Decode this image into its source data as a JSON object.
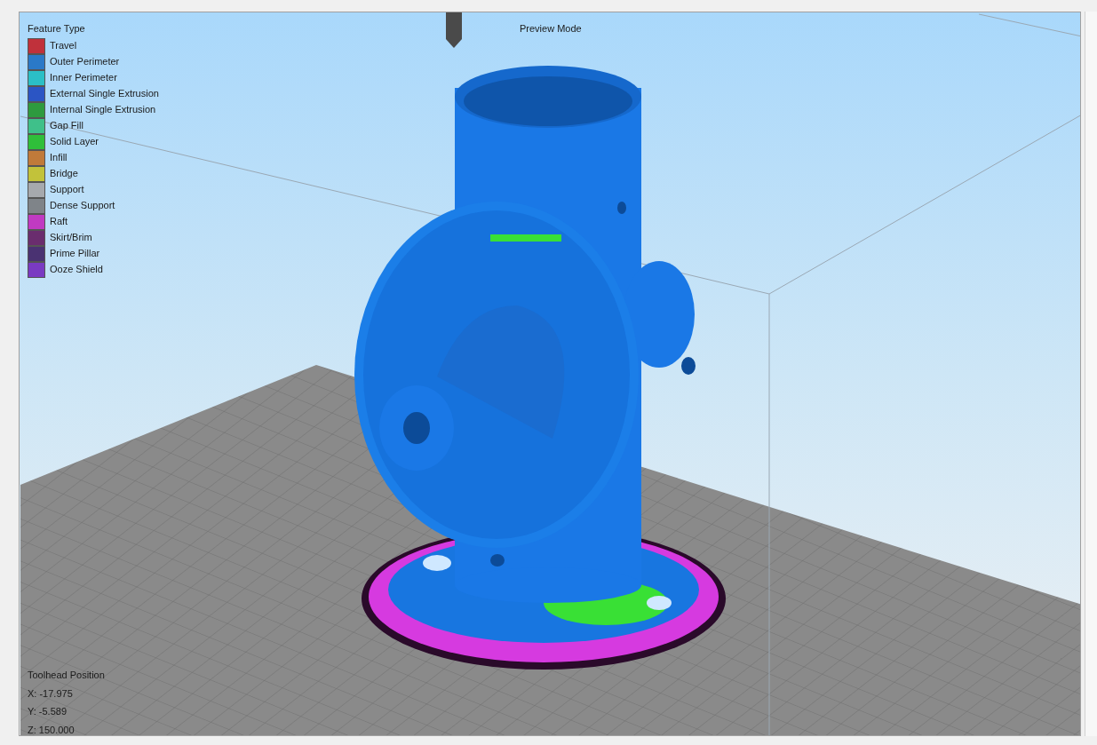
{
  "viewport": {
    "title": "Preview Mode"
  },
  "legend": {
    "title": "Feature Type",
    "items": [
      {
        "label": "Travel",
        "color": "#c0313b"
      },
      {
        "label": "Outer Perimeter",
        "color": "#2a79c8"
      },
      {
        "label": "Inner Perimeter",
        "color": "#2bbfc6"
      },
      {
        "label": "External Single Extrusion",
        "color": "#2b55c4"
      },
      {
        "label": "Internal Single Extrusion",
        "color": "#2e9a3f"
      },
      {
        "label": "Gap Fill",
        "color": "#3fc08a"
      },
      {
        "label": "Solid Layer",
        "color": "#2fbf3a"
      },
      {
        "label": "Infill",
        "color": "#c07a3a"
      },
      {
        "label": "Bridge",
        "color": "#c2c23a"
      },
      {
        "label": "Support",
        "color": "#a6a9ad"
      },
      {
        "label": "Dense Support",
        "color": "#7f8489"
      },
      {
        "label": "Raft",
        "color": "#c03ac2"
      },
      {
        "label": "Skirt/Brim",
        "color": "#6a2d6e"
      },
      {
        "label": "Prime Pillar",
        "color": "#4a3272"
      },
      {
        "label": "Ooze Shield",
        "color": "#7a3ac2"
      }
    ]
  },
  "toolhead": {
    "title": "Toolhead Position",
    "lines": [
      "X: -17.975",
      "Y: -5.589",
      "Z: 150.000"
    ]
  }
}
